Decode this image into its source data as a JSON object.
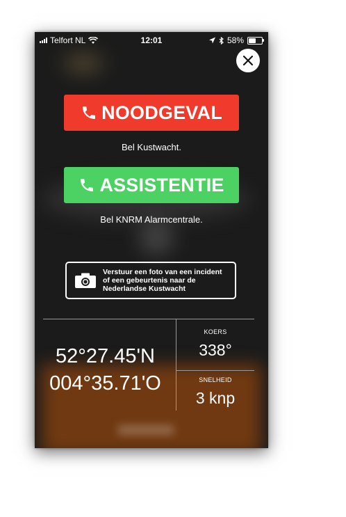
{
  "status_bar": {
    "carrier": "Telfort NL",
    "time": "12:01",
    "battery_percent": "58%",
    "battery_level": 0.58,
    "icons": [
      "signal-icon",
      "wifi-icon",
      "location-arrow-icon",
      "bluetooth-icon",
      "battery-icon"
    ]
  },
  "close_icon": "close-icon",
  "emergency": {
    "label": "NOODGEVAL",
    "subtitle": "Bel Kustwacht.",
    "color": "#f03a2b",
    "icon": "phone-icon"
  },
  "assistance": {
    "label": "ASSISTENTIE",
    "subtitle": "Bel KNRM Alarmcentrale.",
    "color": "#4cd163",
    "icon": "phone-icon"
  },
  "photo": {
    "line1": "Verstuur een foto van een incident",
    "line2": "of een gebeurtenis naar de",
    "line3": "Nederlandse Kustwacht",
    "icon": "camera-icon"
  },
  "position": {
    "lat": "52°27.45'N",
    "lon": "004°35.71'O"
  },
  "course": {
    "label": "KOERS",
    "value": "338°"
  },
  "speed": {
    "label": "SNELHEID",
    "value": "3 knp"
  }
}
